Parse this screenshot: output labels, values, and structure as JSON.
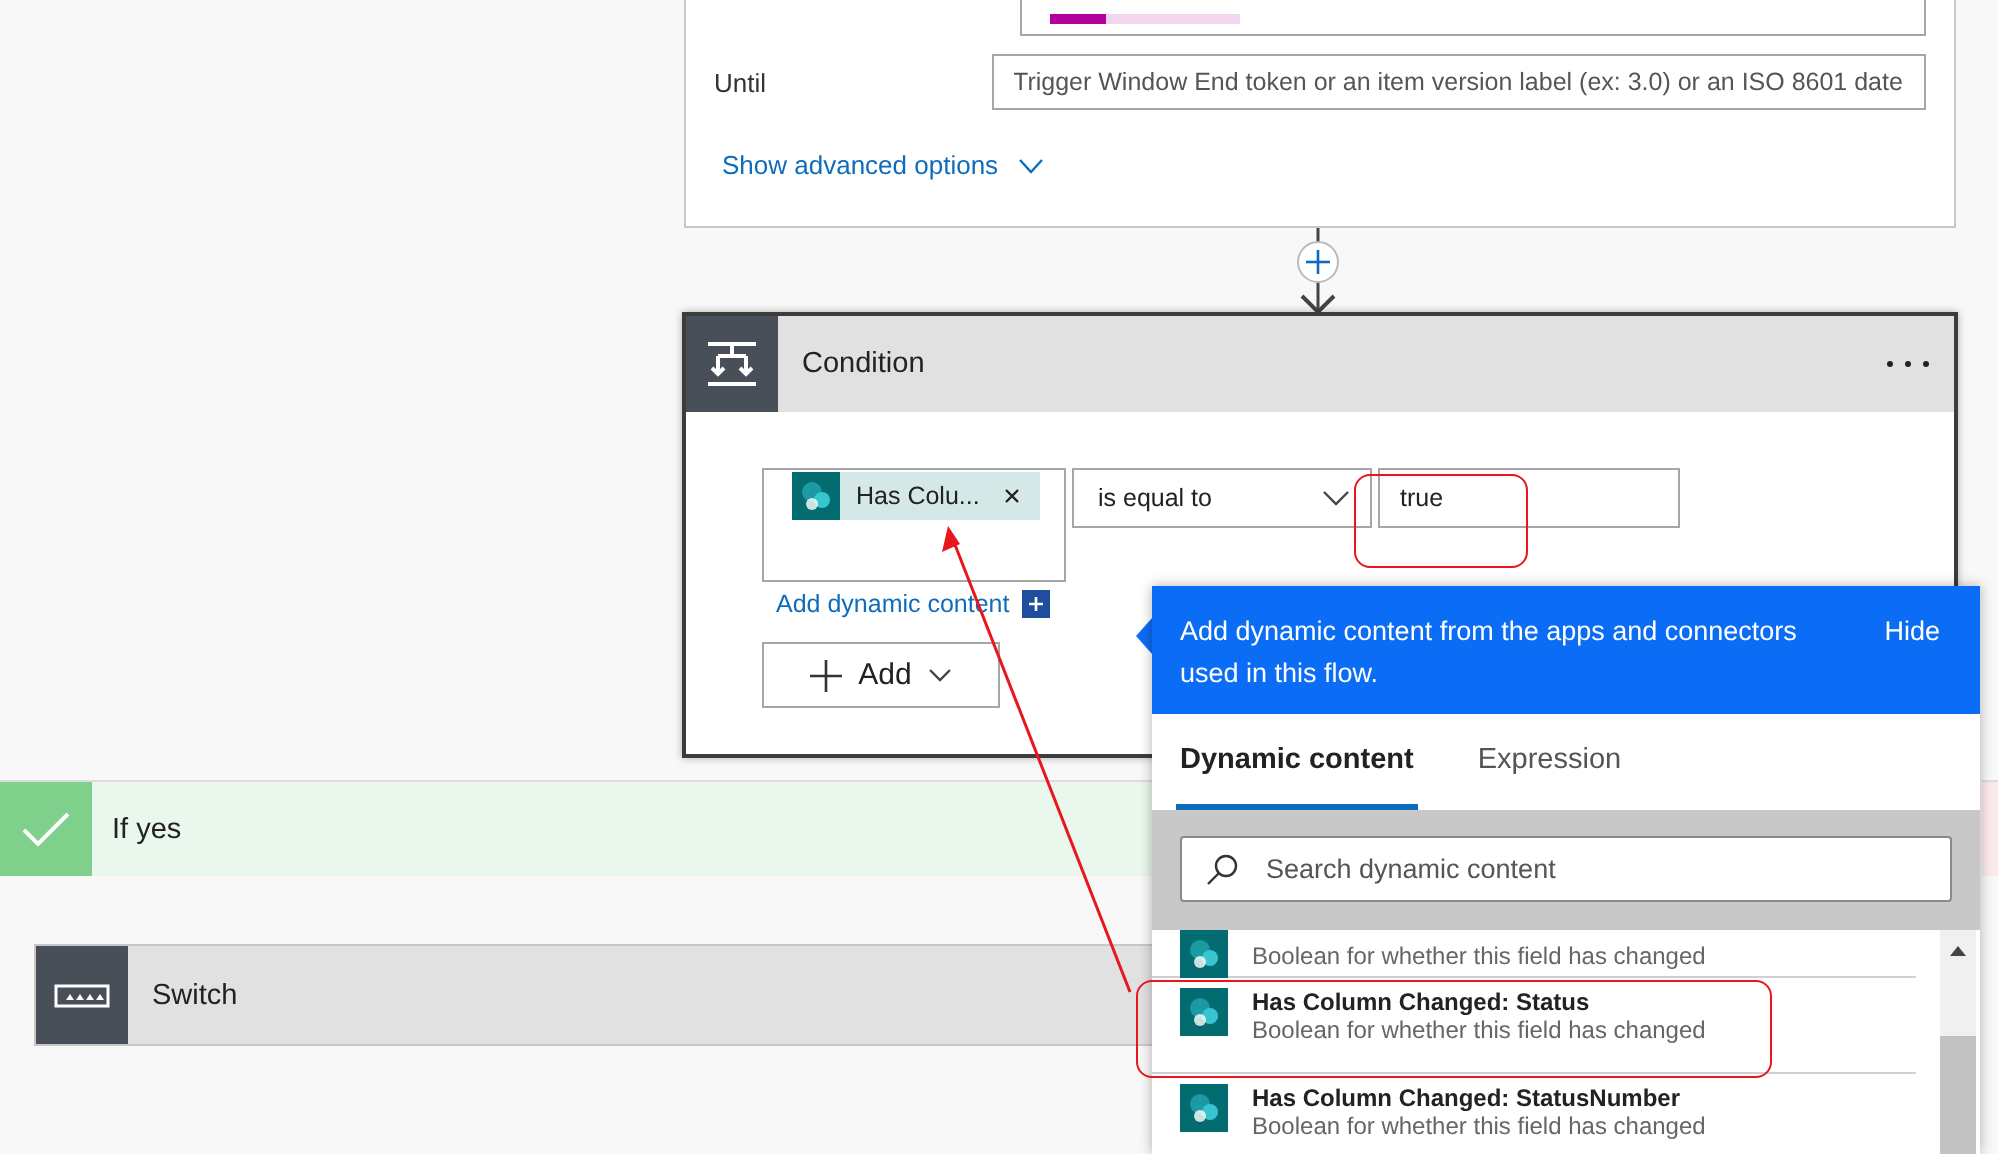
{
  "top_card": {
    "partial_field": {
      "level": 0.29
    },
    "until_label": "Until",
    "until_placeholder": "Trigger Window End token or an item version label (ex: 3.0) or an ISO 8601 date",
    "advanced_link": "Show advanced options"
  },
  "condition": {
    "title": "Condition",
    "token": "Has Colu...",
    "operator": "is equal to",
    "value": "true",
    "add_dynamic": "Add dynamic content",
    "add_button": "Add"
  },
  "branches": [
    {
      "kind": "yes",
      "label": "If yes"
    },
    {
      "kind": "no"
    }
  ],
  "actions": [
    {
      "title": "Switch"
    }
  ],
  "popup": {
    "message": "Add dynamic content from the apps and connectors used in this flow.",
    "hide": "Hide",
    "tabs": [
      {
        "label": "Dynamic content",
        "selected": true
      },
      {
        "label": "Expression",
        "selected": false
      }
    ],
    "search_placeholder": "Search dynamic content",
    "items": [
      {
        "description": "Boolean for whether this field has changed"
      },
      {
        "title": "Has Column Changed: Status",
        "description": "Boolean for whether this field has changed"
      },
      {
        "title": "Has Column Changed: StatusNumber",
        "description": "Boolean for whether this field has changed"
      }
    ]
  }
}
